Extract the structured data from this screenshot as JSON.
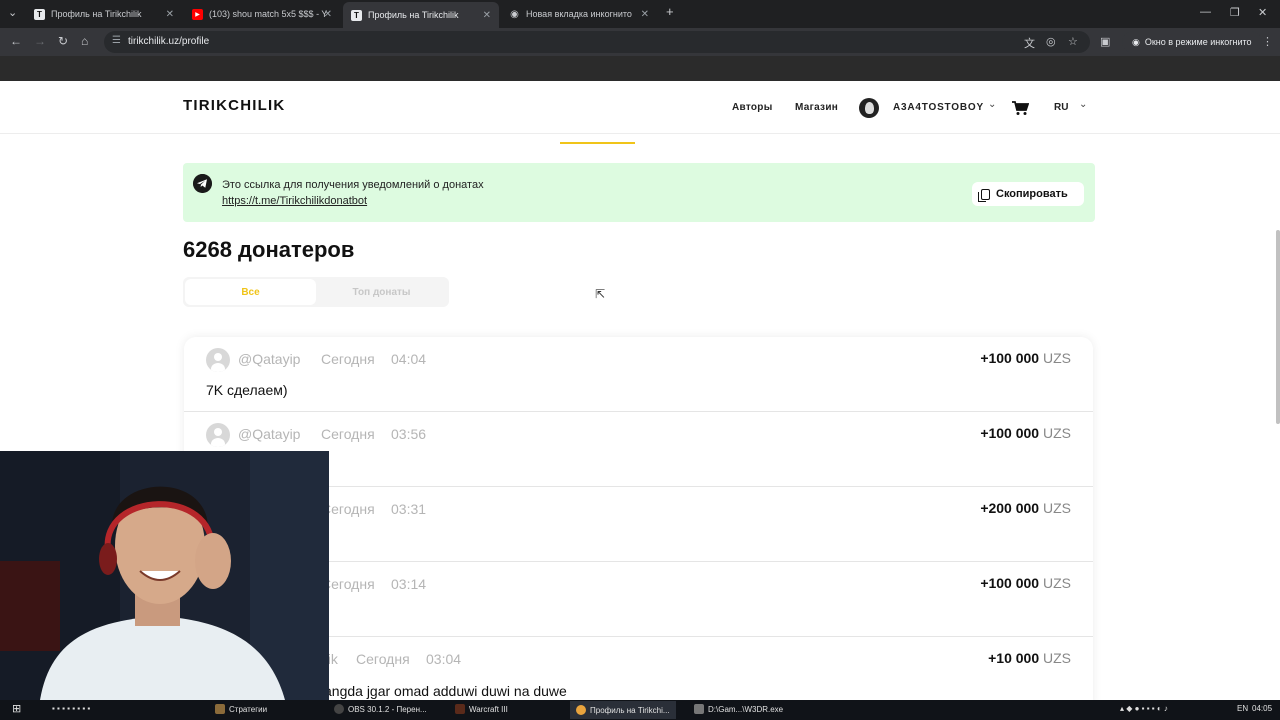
{
  "browser": {
    "tabs": [
      {
        "title": "Профиль на Tirikchilik",
        "favicon": "T",
        "active": false
      },
      {
        "title": "(103) shou match 5x5 $$$ - You",
        "favicon": "yt",
        "active": false
      },
      {
        "title": "Профиль на Tirikchilik",
        "favicon": "T",
        "active": true
      },
      {
        "title": "Новая вкладка инкогнито",
        "favicon": "incognito",
        "active": false
      }
    ],
    "new_tab_glyph": "+",
    "url": "tirikchilik.uz/profile",
    "incognito_label": "Окно в режиме инкогнито"
  },
  "site": {
    "logo": "TIRIKCHILIK",
    "nav": {
      "authors": "Авторы",
      "shop": "Магазин"
    },
    "username": "A3A4TOSTOBOY",
    "language": "RU",
    "accent_color": "#f0c419"
  },
  "banner": {
    "text": "Это ссылка для получения уведомлений о донатах",
    "link": "https://t.me/Tirikchilikdonatbot",
    "copy_label": "Скопировать",
    "background": "#ddfbe0"
  },
  "donors": {
    "count_label": "6268 донатеров",
    "tabs": {
      "all": "Все",
      "top": "Топ донаты"
    }
  },
  "donations": [
    {
      "name": "@Qatayip",
      "day": "Сегодня",
      "time": "04:04",
      "amount": "+100 000",
      "currency": "UZS",
      "message": "7K сделаем)"
    },
    {
      "name": "@Qatayip",
      "day": "Сегодня",
      "time": "03:56",
      "amount": "+100 000",
      "currency": "UZS",
      "message": ""
    },
    {
      "name": "",
      "day": "Сегодня",
      "time": "03:31",
      "amount": "+200 000",
      "currency": "UZS",
      "message": ""
    },
    {
      "name": "",
      "day": "Сегодня",
      "time": "03:14",
      "amount": "+100 000",
      "currency": "UZS",
      "message": ""
    },
    {
      "name": "hik",
      "day": "Сегодня",
      "time": "03:04",
      "amount": "+10 000",
      "currency": "UZS",
      "message": "angda jgar omad adduwi duwi na duwe"
    }
  ],
  "taskbar": {
    "items": [
      "Стратегии",
      "OBS 30.1.2 - Перен...",
      "Warcraft III",
      "Профиль на Tirikchi...",
      "D:\\Gam...\\W3DR.exe"
    ],
    "lang": "EN",
    "clock": "04:05"
  }
}
